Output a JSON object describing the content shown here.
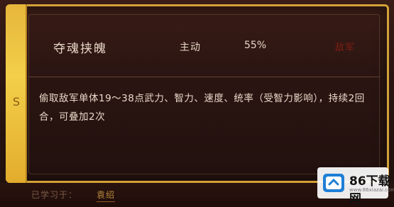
{
  "skill": {
    "name": "夺魂挟魄",
    "type": "主动",
    "rate": "55%",
    "target": "敌军",
    "grade": "S",
    "description": "偷取敌军单体19～38点武力、智力、速度、统率（受智力影响），持续2回合，可叠加2次"
  },
  "footer": {
    "learned_label": "已学习于：",
    "learned_value": "袁绍"
  },
  "watermark": {
    "title": "86下载网",
    "sub": "www.86xiazai.com"
  },
  "colors": {
    "frame_gold": "#d3a238",
    "grade_bar": "#f3cf4a",
    "target_red": "#7f1e12",
    "text_light": "#e8d6c6"
  }
}
